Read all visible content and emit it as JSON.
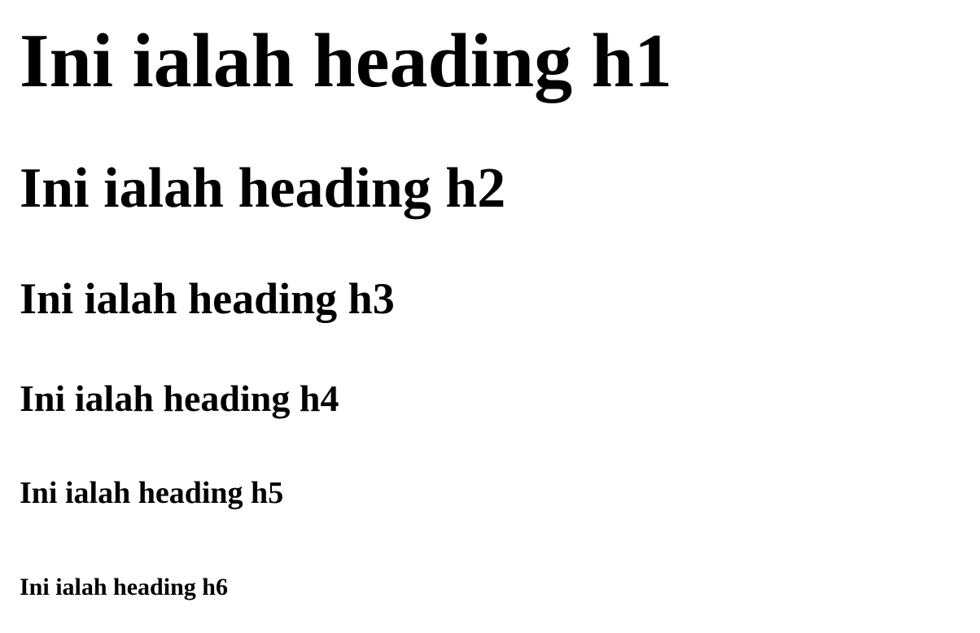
{
  "headings": {
    "h1": "Ini ialah heading h1",
    "h2": "Ini ialah heading h2",
    "h3": "Ini ialah heading h3",
    "h4": "Ini ialah heading h4",
    "h5": "Ini ialah heading h5",
    "h6": "Ini ialah heading h6"
  },
  "colors": {
    "background": "#ffffff",
    "text": "#000000"
  }
}
